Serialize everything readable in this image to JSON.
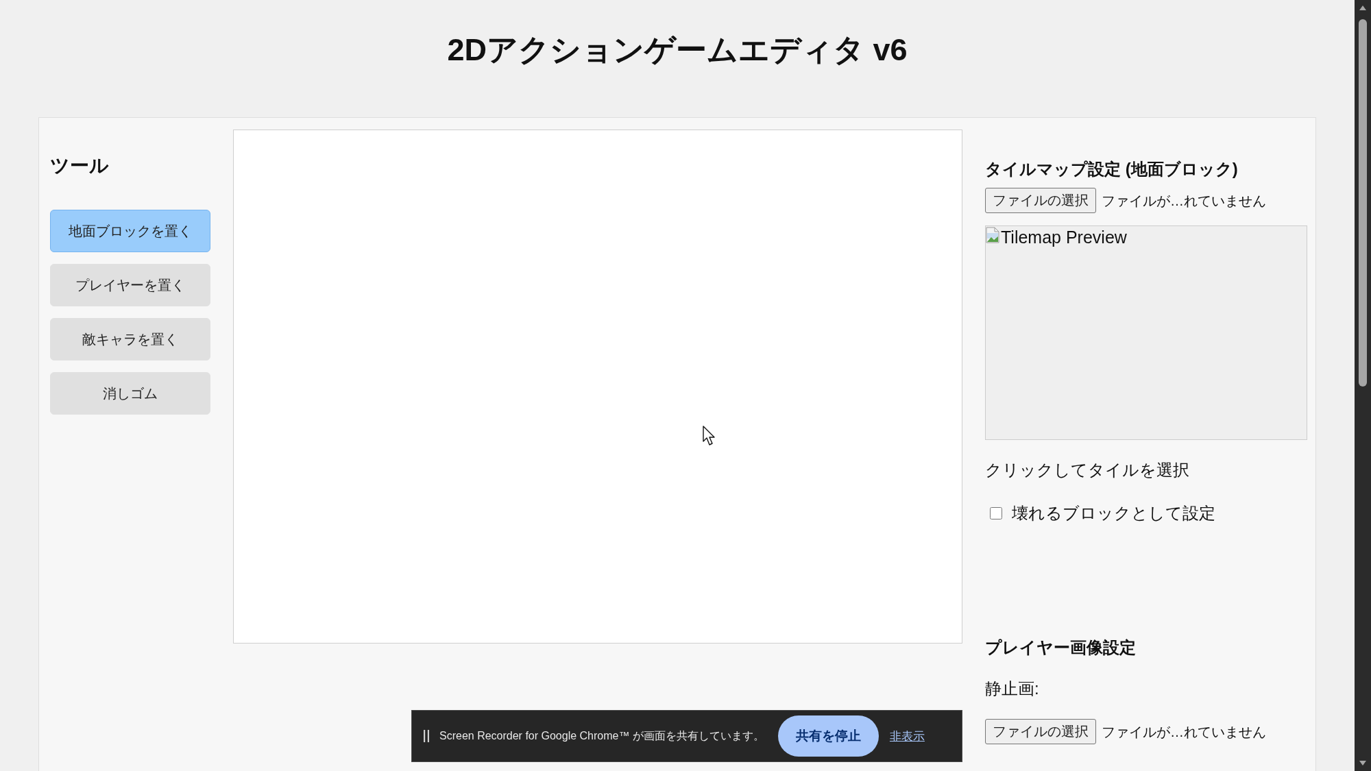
{
  "title": "2Dアクションゲームエディタ v6",
  "tools": {
    "heading": "ツール",
    "items": [
      {
        "label": "地面ブロックを置く",
        "selected": true
      },
      {
        "label": "プレイヤーを置く",
        "selected": false
      },
      {
        "label": "敵キャラを置く",
        "selected": false
      },
      {
        "label": "消しゴム",
        "selected": false
      }
    ]
  },
  "tilemap_settings": {
    "heading": "タイルマップ設定 (地面ブロック)",
    "file_input": {
      "button": "ファイルの選択",
      "status": "ファイルが…れていません"
    },
    "preview": {
      "alt_text": "Tilemap Preview"
    },
    "hint": "クリックしてタイルを選択",
    "breakable": {
      "label": "壊れるブロックとして設定",
      "checked": false
    }
  },
  "player_image_settings": {
    "heading": "プレイヤー画像設定",
    "still_label": "静止画:",
    "file_input": {
      "button": "ファイルの選択",
      "status": "ファイルが…れていません"
    }
  },
  "share_banner": {
    "message": "Screen Recorder for Google Chrome™ が画面を共有しています。",
    "stop_button": "共有を停止",
    "hide_link": "非表示"
  }
}
